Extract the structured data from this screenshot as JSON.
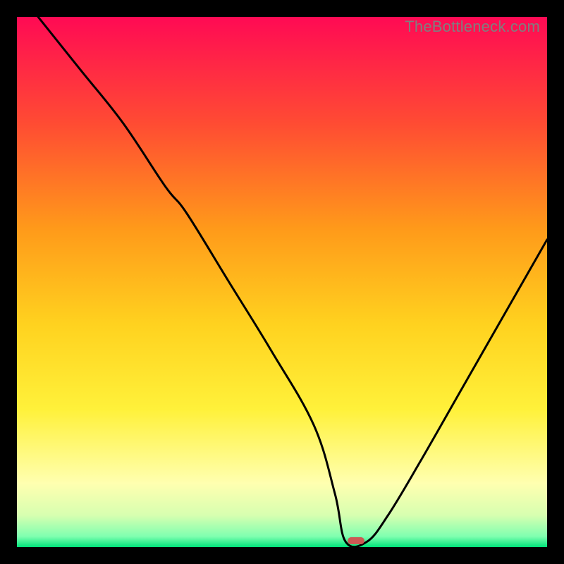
{
  "watermark": "TheBottleneck.com",
  "colors": {
    "curve": "#000000",
    "marker": "#cc5a54",
    "frame": "#000000"
  },
  "chart_data": {
    "type": "line",
    "title": "",
    "xlabel": "",
    "ylabel": "",
    "xlim": [
      0,
      100
    ],
    "ylim": [
      0,
      100
    ],
    "grid": false,
    "legend": false,
    "gradient_stops": [
      {
        "offset": 0.0,
        "color": "#ff0a54"
      },
      {
        "offset": 0.2,
        "color": "#ff4b33"
      },
      {
        "offset": 0.4,
        "color": "#ff9a1a"
      },
      {
        "offset": 0.58,
        "color": "#ffd21f"
      },
      {
        "offset": 0.74,
        "color": "#fff13a"
      },
      {
        "offset": 0.88,
        "color": "#ffffb0"
      },
      {
        "offset": 0.94,
        "color": "#d7ffb0"
      },
      {
        "offset": 0.98,
        "color": "#7fffb0"
      },
      {
        "offset": 1.0,
        "color": "#00e47a"
      }
    ],
    "series": [
      {
        "name": "bottleneck-curve",
        "x": [
          4,
          12,
          20,
          28,
          32,
          40,
          48,
          56,
          60,
          62,
          66,
          70,
          76,
          84,
          92,
          100
        ],
        "y": [
          100,
          90,
          80,
          68,
          63,
          50,
          37,
          23,
          10,
          1,
          1,
          6,
          16,
          30,
          44,
          58
        ]
      }
    ],
    "marker": {
      "x": 64,
      "y": 1.2,
      "width_pct": 3.2,
      "height_pct": 1.4
    }
  }
}
